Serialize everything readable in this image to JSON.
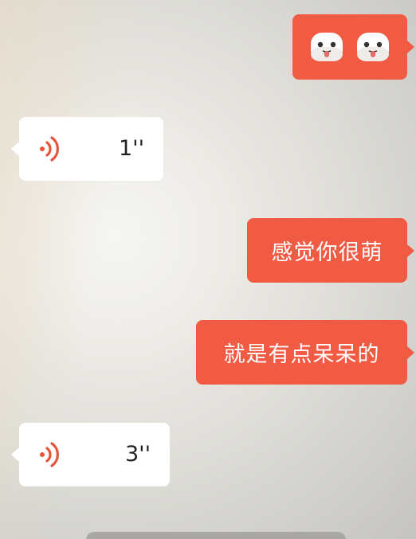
{
  "chat": {
    "messages": [
      {
        "id": 1,
        "sender": "me",
        "type": "emoji",
        "emoji": [
          "tongue-face-emoji",
          "tongue-face-emoji"
        ]
      },
      {
        "id": 2,
        "sender": "other",
        "type": "voice",
        "icon": "voice-wave-icon",
        "duration": "1''"
      },
      {
        "id": 3,
        "sender": "me",
        "type": "text",
        "text": "感觉你很萌"
      },
      {
        "id": 4,
        "sender": "me",
        "type": "text",
        "text": "就是有点呆呆的"
      },
      {
        "id": 5,
        "sender": "other",
        "type": "voice",
        "icon": "voice-wave-icon",
        "duration": "3''"
      }
    ]
  },
  "colors": {
    "outgoing_bubble": "#f15b43",
    "incoming_bubble": "#ffffff",
    "voice_icon": "#e5533c"
  }
}
